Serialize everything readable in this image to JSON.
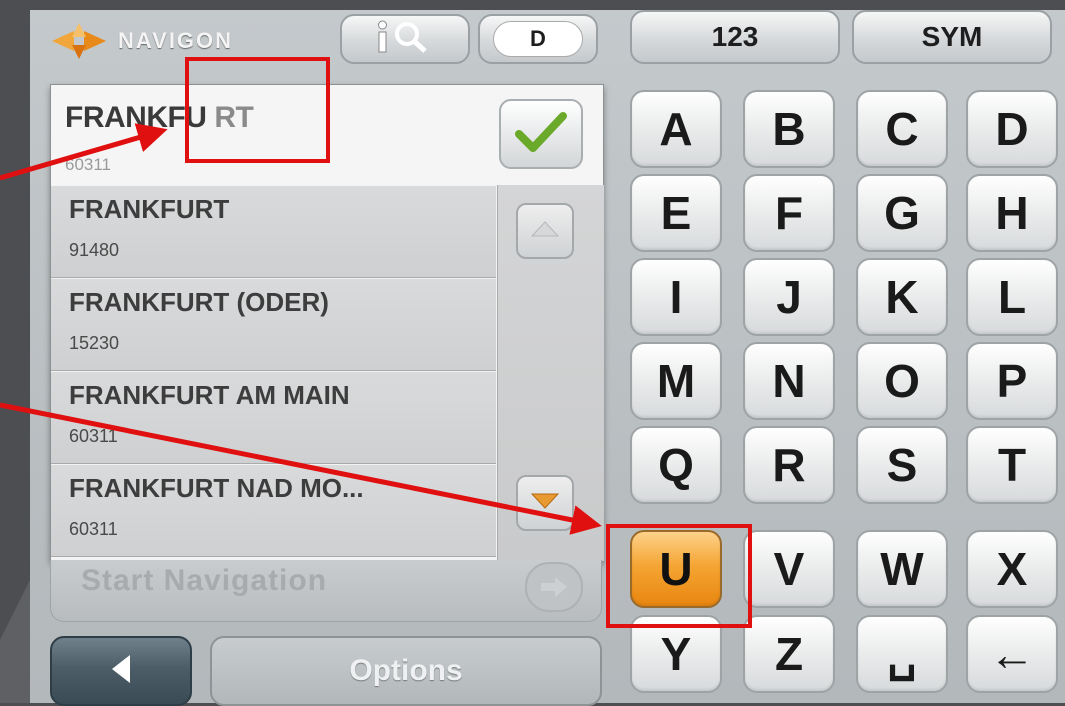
{
  "brand": {
    "logo_text": "NAVIGON"
  },
  "top_bar": {
    "info_icon": "info-search-icon",
    "language": "D"
  },
  "keyboard_modes": {
    "numeric": "123",
    "symbols": "SYM"
  },
  "entry": {
    "typed": "FRANKFU",
    "suggested": " RT",
    "postal_code": "60311",
    "confirm_icon": "checkmark-icon"
  },
  "results": [
    {
      "name": "FRANKFURT",
      "postal_code": "91480"
    },
    {
      "name": "FRANKFURT (ODER)",
      "postal_code": "15230"
    },
    {
      "name": "FRANKFURT AM MAIN",
      "postal_code": "60311"
    },
    {
      "name": "FRANKFURT NAD MO...",
      "postal_code": "60311"
    }
  ],
  "bottom": {
    "start_label": "Start Navigation",
    "back_icon": "back-arrow-icon",
    "options_label": "Options"
  },
  "keyboard": {
    "rows": [
      [
        "A",
        "B",
        "C",
        "D"
      ],
      [
        "E",
        "F",
        "G",
        "H"
      ],
      [
        "I",
        "J",
        "K",
        "L"
      ],
      [
        "M",
        "N",
        "O",
        "P"
      ],
      [
        "Q",
        "R",
        "S",
        "T"
      ],
      [
        "U",
        "V",
        "W",
        "X"
      ],
      [
        "Y",
        "Z",
        "␣",
        "←"
      ]
    ],
    "active_key": "U"
  },
  "colors": {
    "highlight": "#e01010",
    "active_key": "#f5a534"
  }
}
